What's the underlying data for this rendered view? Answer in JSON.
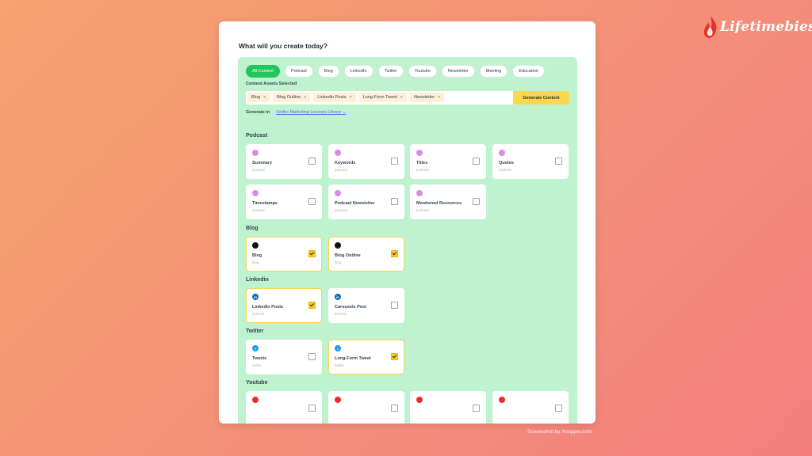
{
  "brand": {
    "name": "Lifetimebies"
  },
  "page": {
    "heading": "What will you create today?"
  },
  "tabs": [
    "All Content",
    "Podcast",
    "Blog",
    "LinkedIn",
    "Twitter",
    "Youtube",
    "Newsletter",
    "Meeting",
    "Education"
  ],
  "assets": {
    "label": "Content Assets Selected",
    "chips": [
      "Blog",
      "Blog Outline",
      "LinkedIn Posts",
      "Long-Form Tweet",
      "Newsletter"
    ],
    "remove_glyph": "×"
  },
  "generate_button": "Generate Content",
  "generate_in": {
    "label": "Generate in",
    "library": "Unifire Marketing Lessons Library",
    "chevron": "⌄"
  },
  "sections": {
    "podcast": {
      "title": "Podcast",
      "cards": [
        {
          "title": "Summary",
          "sub": "podcast",
          "checked": false
        },
        {
          "title": "Keywords",
          "sub": "podcast",
          "checked": false
        },
        {
          "title": "Titles",
          "sub": "podcast",
          "checked": false
        },
        {
          "title": "Quotes",
          "sub": "podcast",
          "checked": false
        },
        {
          "title": "Timestamps",
          "sub": "podcast",
          "checked": false
        },
        {
          "title": "Podcast Newsletter",
          "sub": "podcast",
          "checked": false
        },
        {
          "title": "Mentioned Resources",
          "sub": "podcast",
          "checked": false
        }
      ]
    },
    "blog": {
      "title": "Blog",
      "cards": [
        {
          "title": "Blog",
          "sub": "blog",
          "checked": true
        },
        {
          "title": "Blog Outline",
          "sub": "blog",
          "checked": true
        }
      ]
    },
    "linkedin": {
      "title": "Linkedin",
      "cards": [
        {
          "title": "LinkedIn Posts",
          "sub": "linkedin",
          "checked": true
        },
        {
          "title": "Carousels Post",
          "sub": "linkedin",
          "checked": false
        }
      ]
    },
    "twitter": {
      "title": "Twitter",
      "cards": [
        {
          "title": "Tweets",
          "sub": "twitter",
          "checked": false
        },
        {
          "title": "Long-Form Tweet",
          "sub": "twitter",
          "checked": true
        }
      ]
    },
    "youtube": {
      "title": "Youtube"
    }
  },
  "icon_glyphs": {
    "linkedin": "in",
    "twitter": "t"
  },
  "colors": {
    "green_panel": "#bff2cf",
    "active_tab": "#22c55e",
    "generate_button": "#fbd74c",
    "chip": "#fdf0d5"
  },
  "credit": "Screenshot by Xnapper.com"
}
